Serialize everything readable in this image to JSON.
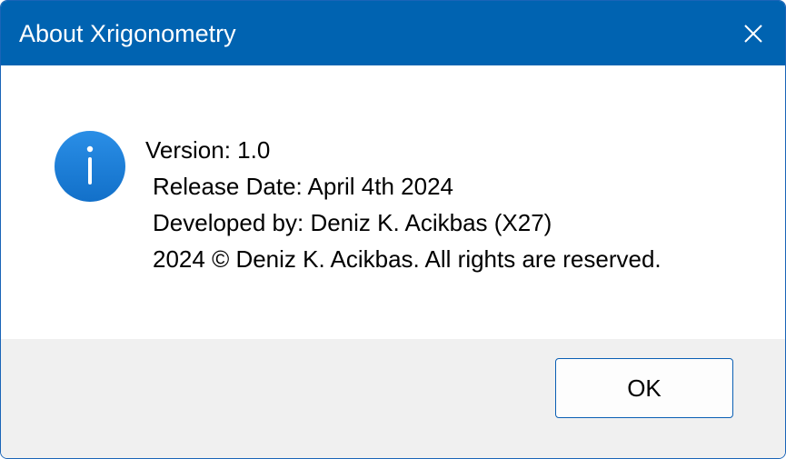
{
  "window": {
    "title": "About Xrigonometry",
    "close_icon": "close-icon",
    "titlebar_color": "#0063b1"
  },
  "message": {
    "icon": "info-icon",
    "icon_color": "#1a7fd9",
    "lines": [
      "Version: 1.0",
      "Release Date: April 4th 2024",
      "Developed by: Deniz K. Acikbas (X27)",
      "2024 © Deniz K. Acikbas. All rights are reserved."
    ]
  },
  "buttons": {
    "ok_label": "OK"
  }
}
